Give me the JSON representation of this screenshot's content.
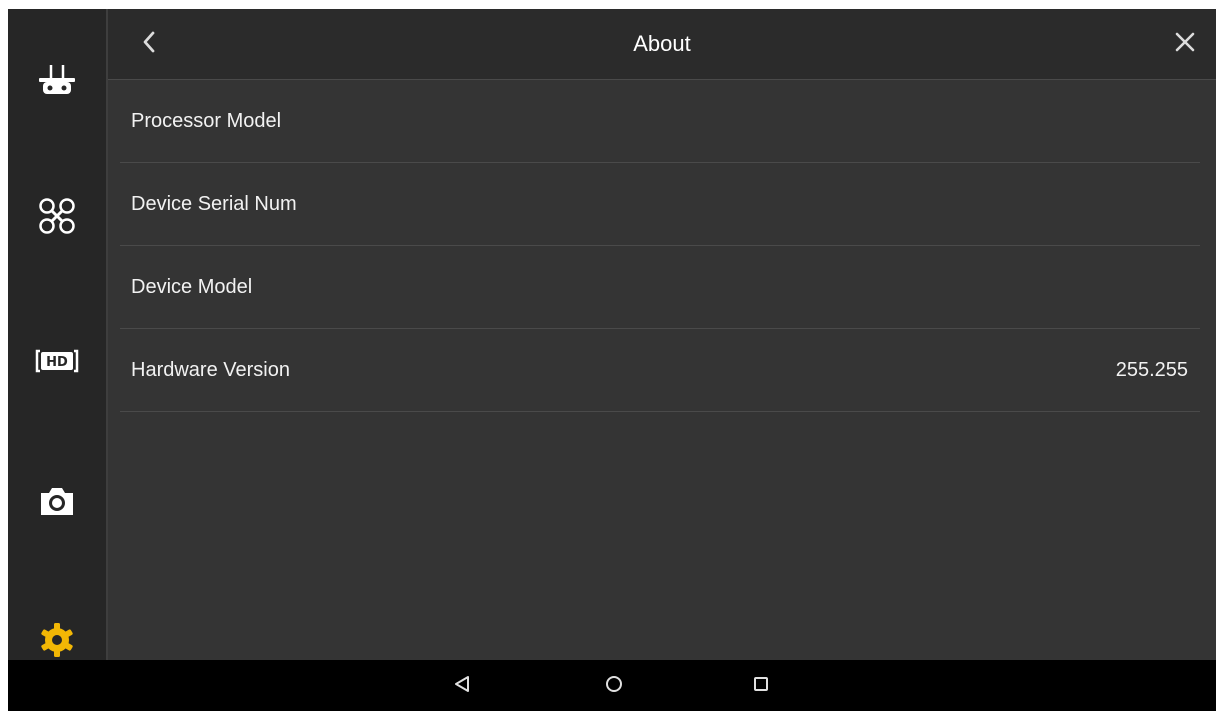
{
  "header": {
    "title": "About",
    "back_icon": "chevron-left-icon",
    "close_icon": "close-icon"
  },
  "sidebar": {
    "items": [
      {
        "icon": "remote-controller-icon"
      },
      {
        "icon": "aircraft-icon"
      },
      {
        "icon": "hd-transmission-icon"
      },
      {
        "icon": "camera-icon"
      },
      {
        "icon": "gear-icon",
        "active": true,
        "color": "#f2b705"
      }
    ]
  },
  "rows": [
    {
      "label": "Processor Model",
      "value": ""
    },
    {
      "label": "Device Serial Num",
      "value": ""
    },
    {
      "label": "Device Model",
      "value": ""
    },
    {
      "label": "Hardware Version",
      "value": "255.255"
    }
  ],
  "navbar": {
    "items": [
      "back-triangle-icon",
      "home-circle-icon",
      "recents-square-icon"
    ]
  },
  "colors": {
    "background": "#343434",
    "sidebar": "#262626",
    "accent": "#f2b705",
    "text": "#f2f2f2"
  }
}
